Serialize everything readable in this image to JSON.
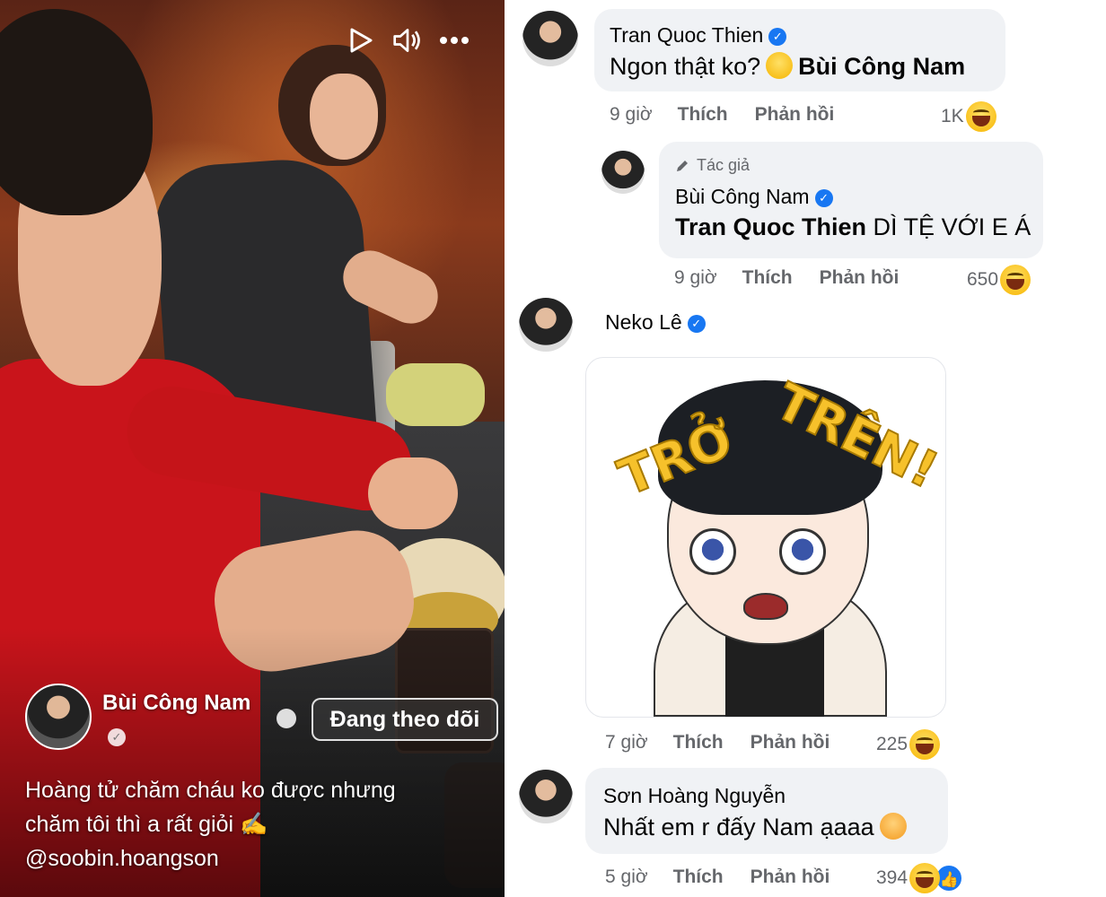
{
  "video": {
    "author_name": "Bùi Công Nam",
    "follow_button": "Đang theo dõi",
    "caption_line1": "Hoàng tử chăm cháu ko được nhưng",
    "caption_line2": "chăm tôi thì a rất giỏi",
    "caption_mention": "@soobin.hoangson",
    "caption_emoji": "✍"
  },
  "comments": [
    {
      "author": "Tran Quoc Thien",
      "text": "Ngon thật ko?",
      "tag": "Bùi Công Nam",
      "time": "9 giờ",
      "like": "Thích",
      "reply": "Phản hồi",
      "reactions": "1K"
    },
    {
      "author_label": "Tác giả",
      "author": "Bùi Công Nam",
      "tag": "Tran Quoc Thien",
      "text": "DÌ TỆ VỚI E Á",
      "time": "9 giờ",
      "like": "Thích",
      "reply": "Phản hồi",
      "reactions": "650"
    },
    {
      "author": "Neko Lê",
      "sticker_words": [
        "TRỞ",
        "TRÊN!"
      ],
      "time": "7 giờ",
      "like": "Thích",
      "reply": "Phản hồi",
      "reactions": "225"
    },
    {
      "author": "Sơn Hoàng Nguyễn",
      "text": "Nhất em r đấy Nam ạaaa",
      "time": "5 giờ",
      "like": "Thích",
      "reply": "Phản hồi",
      "reactions": "394"
    }
  ],
  "icons": {
    "play": "play-icon",
    "volume": "volume-icon",
    "more": "more-icon",
    "verified": "verified-badge-icon",
    "globe": "globe-icon",
    "haha": "haha-reaction-icon",
    "like": "like-reaction-icon",
    "pencil": "pencil-icon"
  },
  "colors": {
    "facebook_blue": "#1877f2",
    "bubble": "#f0f2f5",
    "meta_text": "#65676b"
  }
}
